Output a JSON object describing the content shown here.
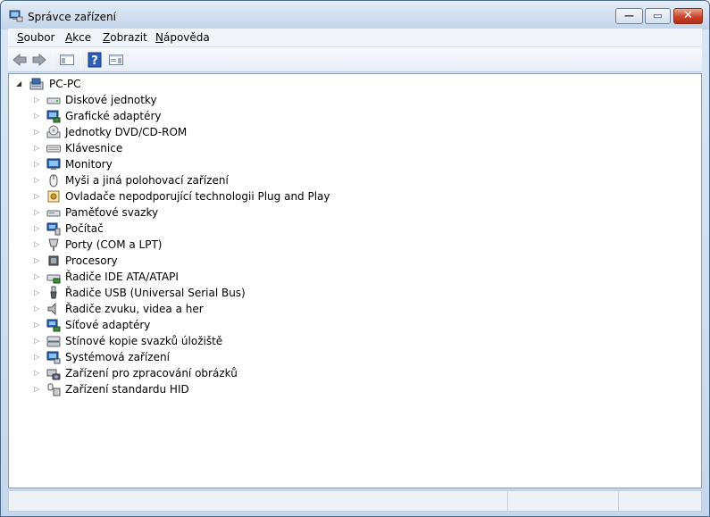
{
  "window": {
    "title": "Správce zařízení"
  },
  "caption_buttons": {
    "minimize": "—",
    "maximize": "▭",
    "close": "✕"
  },
  "menu": {
    "items": [
      "Soubor",
      "Akce",
      "Zobrazit",
      "Nápověda"
    ]
  },
  "tree": {
    "root": "PC-PC",
    "items": [
      {
        "label": "Diskové jednotky",
        "icon": "disk-drive-icon"
      },
      {
        "label": "Grafické adaptéry",
        "icon": "display-adapter-icon"
      },
      {
        "label": "Jednotky DVD/CD-ROM",
        "icon": "dvd-drive-icon"
      },
      {
        "label": "Klávesnice",
        "icon": "keyboard-icon"
      },
      {
        "label": "Monitory",
        "icon": "monitor-icon"
      },
      {
        "label": "Myši a jiná polohovací zařízení",
        "icon": "mouse-icon"
      },
      {
        "label": "Ovladače nepodporující technologii Plug and Play",
        "icon": "non-pnp-driver-icon"
      },
      {
        "label": "Paměťové svazky",
        "icon": "storage-volume-icon"
      },
      {
        "label": "Počítač",
        "icon": "computer-icon"
      },
      {
        "label": "Porty (COM a LPT)",
        "icon": "port-icon"
      },
      {
        "label": "Procesory",
        "icon": "processor-icon"
      },
      {
        "label": "Řadiče IDE ATA/ATAPI",
        "icon": "ide-controller-icon"
      },
      {
        "label": "Řadiče USB (Universal Serial Bus)",
        "icon": "usb-controller-icon"
      },
      {
        "label": "Řadiče zvuku, videa a her",
        "icon": "sound-controller-icon"
      },
      {
        "label": "Síťové adaptéry",
        "icon": "network-adapter-icon"
      },
      {
        "label": "Stínové kopie svazků úložiště",
        "icon": "shadow-copy-icon"
      },
      {
        "label": "Systémová zařízení",
        "icon": "system-device-icon"
      },
      {
        "label": "Zařízení pro zpracování obrázků",
        "icon": "imaging-device-icon"
      },
      {
        "label": "Zařízení standardu HID",
        "icon": "hid-device-icon"
      }
    ]
  }
}
